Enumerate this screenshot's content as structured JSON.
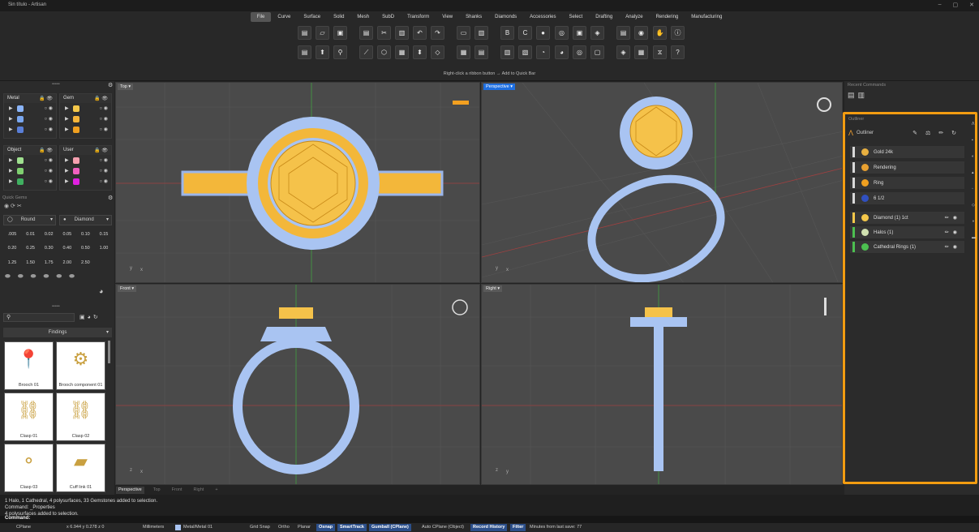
{
  "window": {
    "title": "Sin título - Artisan"
  },
  "menu": [
    "File",
    "Curve",
    "Surface",
    "Solid",
    "Mesh",
    "SubD",
    "Transform",
    "View",
    "Shanks",
    "Diamonds",
    "Accessories",
    "Select",
    "Drafting",
    "Analyze",
    "Rendering",
    "Manufacturing"
  ],
  "ribbon": {
    "hint": "Right-click a ribbon button → Add to Quick Bar"
  },
  "layers": {
    "metal": {
      "title": "Metal",
      "colors": [
        "#8ab4f8",
        "#7aa7f0",
        "#5a7fd8"
      ]
    },
    "gem": {
      "title": "Gem",
      "colors": [
        "#f5c84a",
        "#f5b53a",
        "#f0a020"
      ]
    },
    "object": {
      "title": "Object",
      "colors": [
        "#9fe08f",
        "#7fd070",
        "#40b060"
      ]
    },
    "user": {
      "title": "User",
      "colors": [
        "#f5a0b0",
        "#f060c0",
        "#e020e0"
      ]
    }
  },
  "quick_gems": {
    "title": "Quick Gems",
    "cut": "Round",
    "material": "Diamond",
    "sizes": [
      ".005",
      "0.01",
      "0.02",
      "0.05",
      "0.10",
      "0.15",
      "0.20",
      "0.25",
      "0.30",
      "0.40",
      "0.50",
      "1.00",
      "1.25",
      "1.50",
      "1.75",
      "2.00",
      "2.50"
    ]
  },
  "findings": {
    "title": "Findings",
    "items": [
      "Brooch 01",
      "Brooch component 01",
      "Clasp 01",
      "Clasp 02",
      "Clasp 03",
      "Cuff link 01"
    ]
  },
  "viewports": {
    "top": "Top",
    "perspective": "Perspective",
    "front": "Front",
    "right": "Right",
    "tabs": [
      "Perspective",
      "Top",
      "Front",
      "Right",
      "+"
    ]
  },
  "recent_commands": {
    "title": "Recent Commands"
  },
  "outliner": {
    "panel_title": "Outliner",
    "title": "Outliner",
    "settings": [
      {
        "label": "Gold 24k",
        "bar": "#d8d8d8",
        "icon": "#e8b040"
      },
      {
        "label": "Rendering",
        "bar": "#d8d8d8",
        "icon": "#e8a030"
      },
      {
        "label": "Ring",
        "bar": "#d8d8d8",
        "icon": "#f0a020"
      },
      {
        "label": "6 1/2",
        "bar": "#d8d8d8",
        "icon": "#3050c0"
      }
    ],
    "items": [
      {
        "label": "Diamond (1) 1ct",
        "bar": "#f5c84a",
        "icon": "#f5c84a"
      },
      {
        "label": "Halos (1)",
        "bar": "#4cc050",
        "icon": "#d0e0b0"
      },
      {
        "label": "Cathedral Rings (1)",
        "bar": "#4cc050",
        "icon": "#4cc050"
      }
    ]
  },
  "command_history": [
    "1 Halo, 1 Cathedral, 4 polysurfaces, 33 Gemstones added to selection.",
    "Command: _Properties",
    "4 polysurfaces added to selection."
  ],
  "command_prompt": "Command:",
  "status": {
    "cplane": "CPlane",
    "coords": "x 6.944  y 0.278  z 0",
    "units": "Millimeters",
    "layer": "Metal/Metal 01",
    "toggles": [
      {
        "label": "Grid Snap",
        "on": false
      },
      {
        "label": "Ortho",
        "on": false
      },
      {
        "label": "Planar",
        "on": false
      },
      {
        "label": "Osnap",
        "on": true
      },
      {
        "label": "SmartTrack",
        "on": true
      },
      {
        "label": "Gumball (CPlane)",
        "on": true
      },
      {
        "label": "Auto CPlane (Object)",
        "on": false
      },
      {
        "label": "Record History",
        "on": true
      },
      {
        "label": "Filter",
        "on": true
      }
    ],
    "save_text": "Minutes from last save: 77"
  }
}
